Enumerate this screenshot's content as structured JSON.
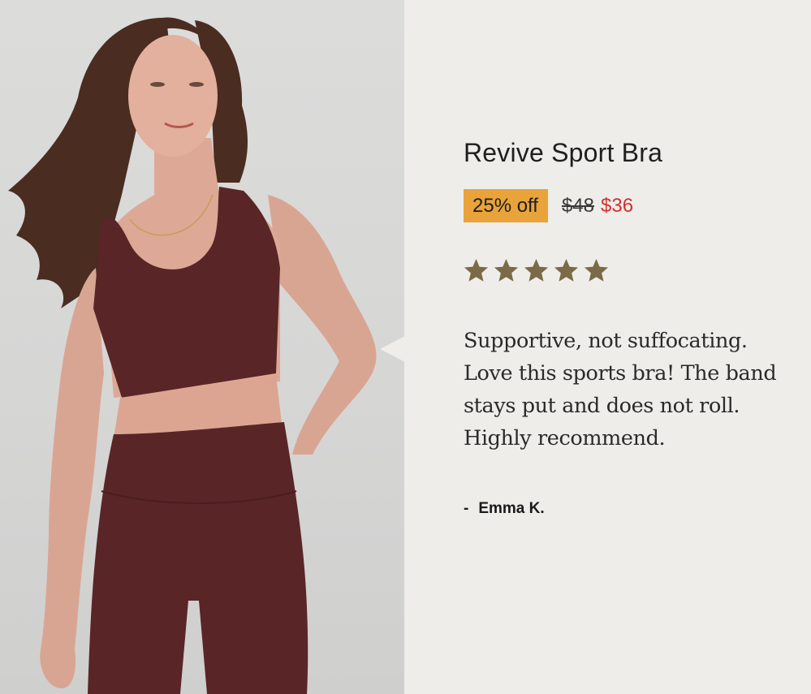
{
  "product": {
    "title": "Revive Sport Bra",
    "discount_label": "25% off",
    "original_price": "$48",
    "sale_price": "$36"
  },
  "review": {
    "rating": 5,
    "rating_max": 5,
    "star_color": "#7a6a46",
    "lines": [
      "Supportive, not suffocating.",
      "Love this sports bra! The band",
      "stays put and does not roll.",
      "Highly recommend."
    ],
    "author_dash": "-",
    "author": "Emma K."
  },
  "colors": {
    "panel_background": "#eeedea",
    "badge_background": "#e8a33a",
    "sale_price": "#d1312e",
    "garment": "#5a2527"
  },
  "photo": {
    "subject": "model-in-sports-bra-and-leggings"
  }
}
